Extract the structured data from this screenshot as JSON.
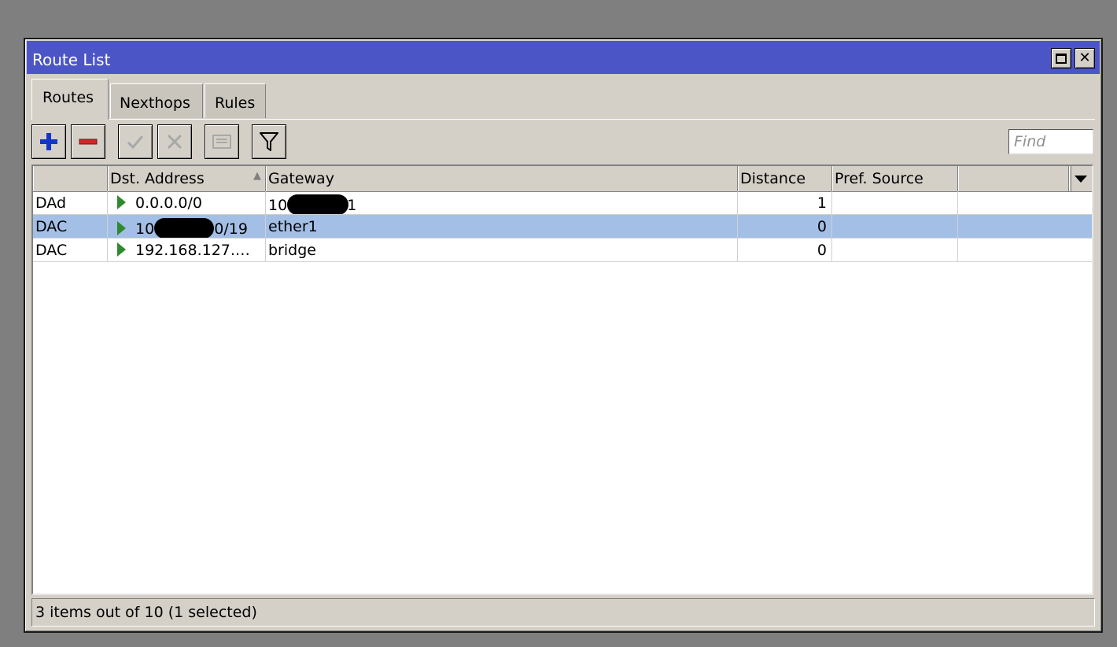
{
  "window": {
    "title": "Route List"
  },
  "tabs": [
    {
      "label": "Routes",
      "active": true
    },
    {
      "label": "Nexthops",
      "active": false
    },
    {
      "label": "Rules",
      "active": false
    }
  ],
  "toolbar": {
    "buttons": [
      {
        "icon": "plus-icon",
        "enabled": true
      },
      {
        "icon": "minus-icon",
        "enabled": true
      },
      {
        "icon": "check-icon",
        "enabled": false
      },
      {
        "icon": "x-icon",
        "enabled": false
      },
      {
        "icon": "comment-icon",
        "enabled": false
      },
      {
        "icon": "filter-icon",
        "enabled": true
      }
    ],
    "find_placeholder": "Find"
  },
  "table": {
    "columns": [
      "",
      "Dst. Address",
      "Gateway",
      "Distance",
      "Pref. Source",
      ""
    ],
    "rows": [
      {
        "flags": "DAd",
        "dst_pre": "0.0.0.0/0",
        "dst_post": "",
        "gw_pre": "10.",
        "gw_post": "1",
        "distance": "1",
        "pref_source": "",
        "selected": false
      },
      {
        "flags": "DAC",
        "dst_pre": "10.",
        "dst_post": ".0/19",
        "gw_pre": "ether1",
        "gw_post": "",
        "distance": "0",
        "pref_source": "",
        "selected": true
      },
      {
        "flags": "DAC",
        "dst_pre": "192.168.127.…",
        "dst_post": "",
        "gw_pre": "bridge",
        "gw_post": "",
        "distance": "0",
        "pref_source": "",
        "selected": false
      }
    ]
  },
  "status": {
    "text": "3 items out of 10 (1 selected)"
  },
  "colors": {
    "title_bar": "#4b55c6",
    "selected_row": "#a3bfe6",
    "active_arrow": "#2f8a2f",
    "plus": "#1436c8",
    "minus": "#cc2a2a"
  }
}
